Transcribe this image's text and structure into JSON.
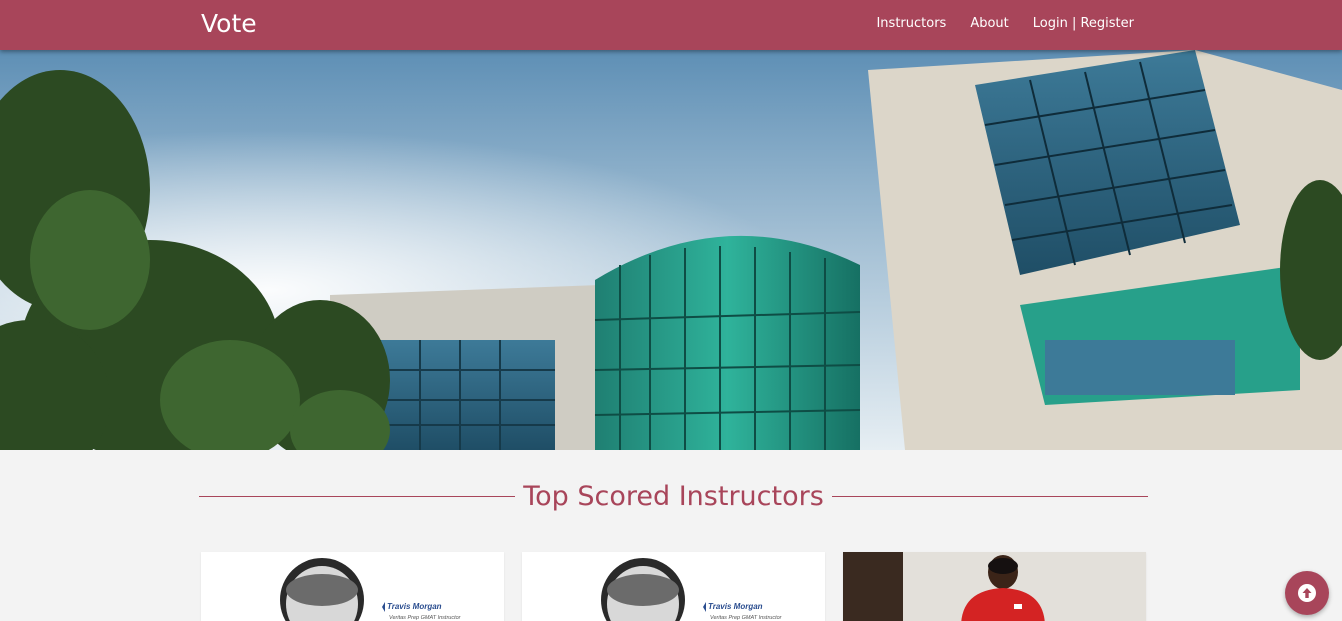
{
  "navbar": {
    "brand": "Vote",
    "links": {
      "instructors": "Instructors",
      "about": "About",
      "login_register": "Login | Register"
    }
  },
  "section": {
    "title": "Top Scored Instructors"
  },
  "instructors": [
    {
      "name": "Travis Morgan",
      "caption": "Veritas Prep GMAT Instructor"
    },
    {
      "name": "Travis Morgan",
      "caption": "Veritas Prep GMAT Instructor"
    },
    {
      "name": "",
      "caption": ""
    }
  ],
  "colors": {
    "brand": "#a8455a",
    "page_bg": "#f3f3f3"
  },
  "icons": {
    "scroll_top": "arrow-up-circle-icon"
  }
}
